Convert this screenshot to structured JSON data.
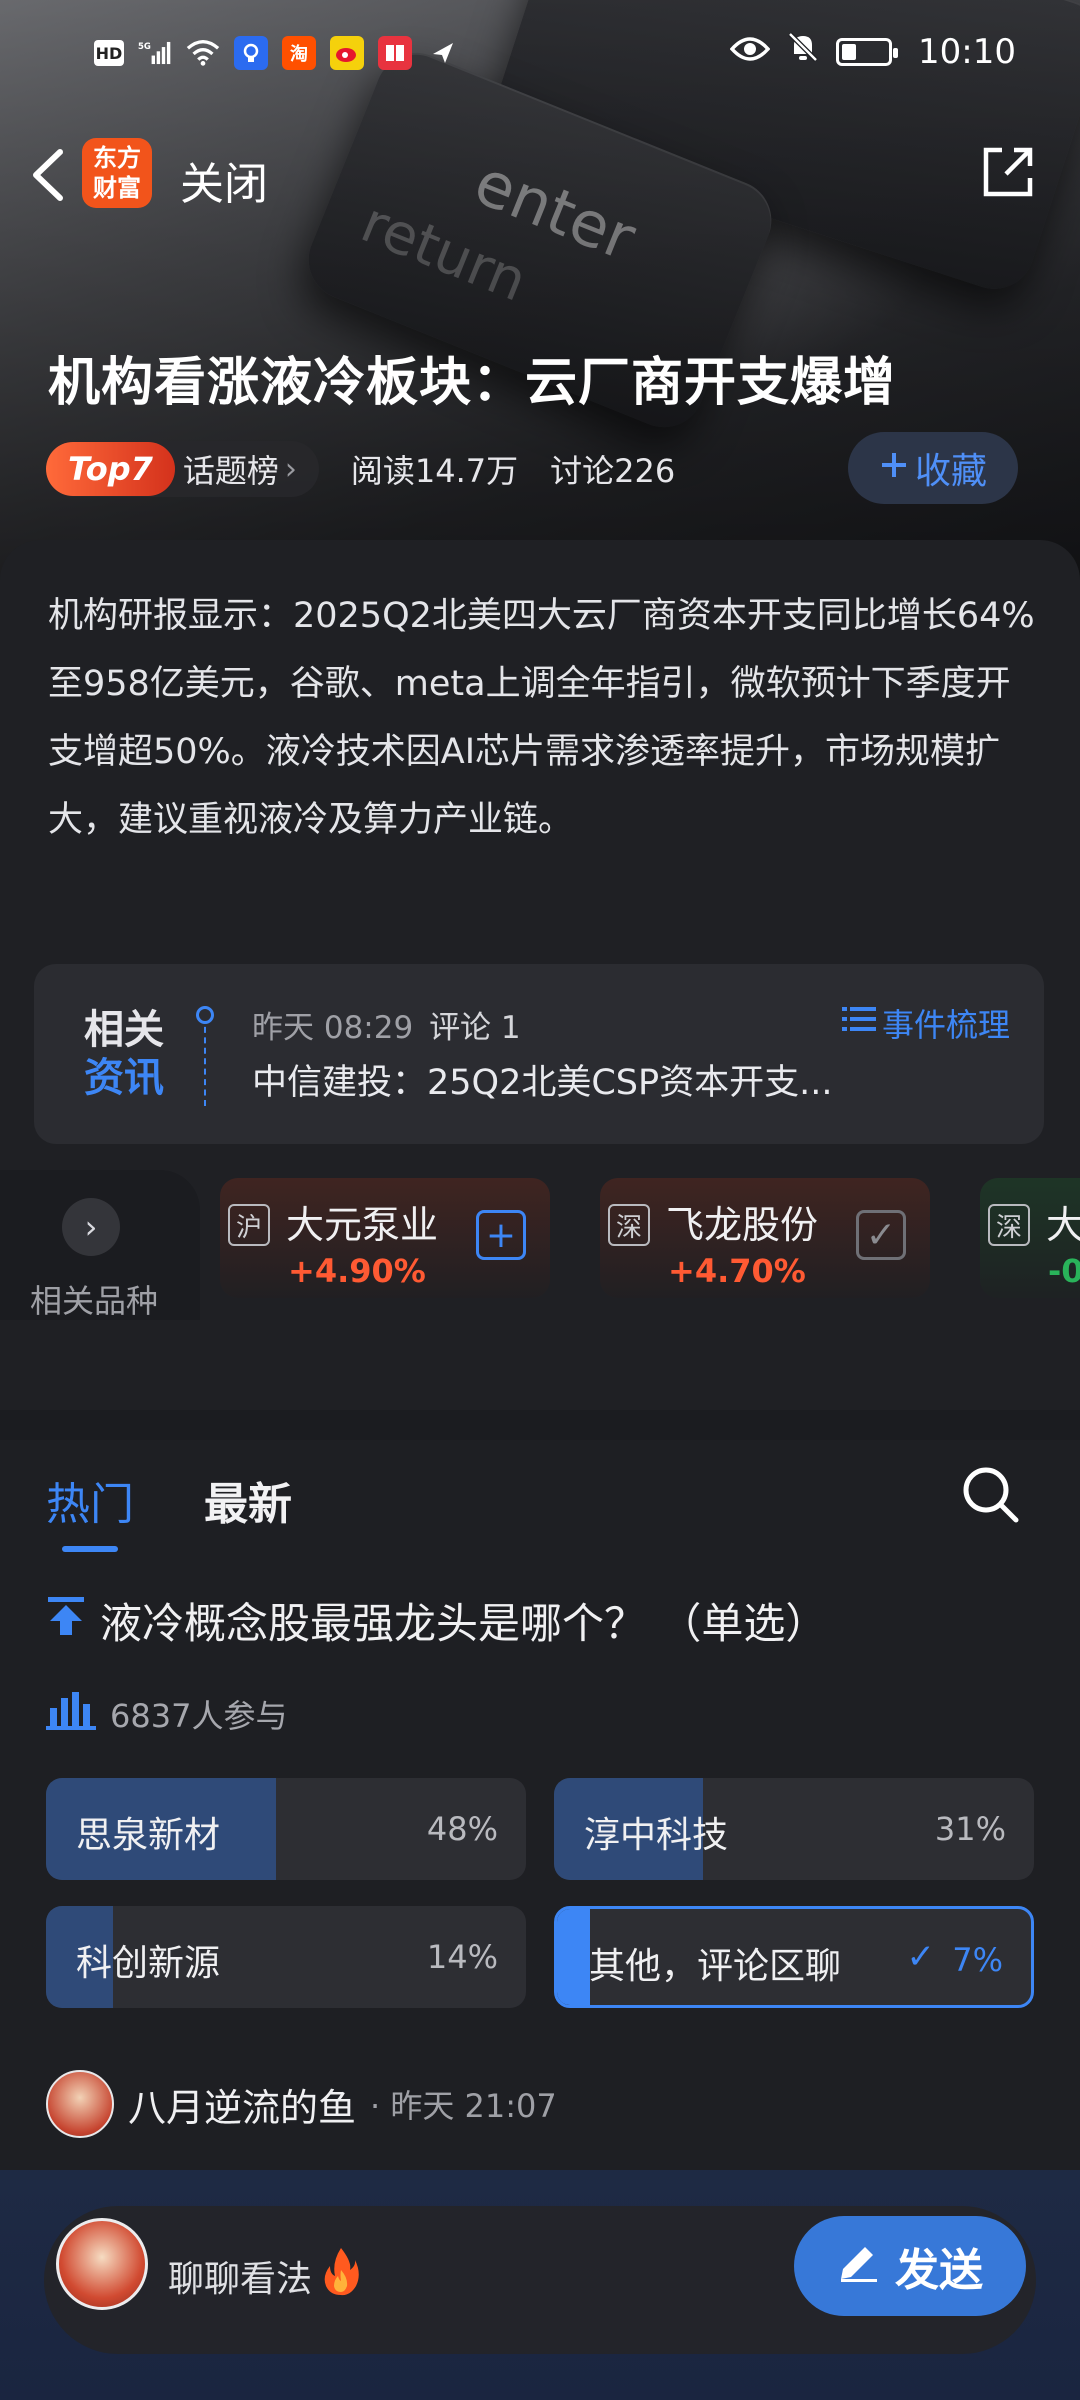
{
  "status_bar": {
    "time": "10:10",
    "left_icons": [
      "hd-icon",
      "signal-5g-icon",
      "wifi-icon",
      "browser-icon",
      "taobao-icon",
      "weibo-icon",
      "reader-icon",
      "send-icon"
    ],
    "hd": "HD",
    "taobao": "淘"
  },
  "nav": {
    "logo_line1": "东方",
    "logo_line2": "财富",
    "close_label": "关闭"
  },
  "hero": {
    "title": "机构看涨液冷板块：云厂商开支爆增",
    "key_text": "enter",
    "key_subtext": "return",
    "topic_badge": "Top7",
    "topic_label": "话题榜",
    "reads": "阅读14.7万",
    "discussions": "讨论226",
    "favorite_label": "收藏"
  },
  "summary": "机构研报显示：2025Q2北美四大云厂商资本开支同比增长64%至958亿美元，谷歌、meta上调全年指引，微软预计下季度开支增超50%。液冷技术因AI芯片需求渗透率提升，市场规模扩大，建议重视液冷及算力产业链。",
  "related_news": {
    "tag_line1": "相关",
    "tag_line2": "资讯",
    "time": "昨天 08:29",
    "comments": "评论 1",
    "headline": "中信建投：25Q2北美CSP资本开支...",
    "link_label": "事件梳理"
  },
  "related_stocks": {
    "label": "相关品种",
    "items": [
      {
        "exchange": "沪",
        "name": "大元泵业",
        "change": "+4.90%",
        "action": "add"
      },
      {
        "exchange": "深",
        "name": "飞龙股份",
        "change": "+4.70%",
        "action": "added"
      },
      {
        "exchange": "深",
        "name": "大",
        "change": "-0",
        "action": "none"
      }
    ]
  },
  "discussion": {
    "tabs": [
      "热门",
      "最新"
    ],
    "poll_question": "液冷概念股最强龙头是哪个？ （单选）",
    "participants": "6837人参与",
    "options": [
      {
        "label": "思泉新材",
        "percent": "48%",
        "fraction": 0.48,
        "selected": false
      },
      {
        "label": "淳中科技",
        "percent": "31%",
        "fraction": 0.31,
        "selected": false
      },
      {
        "label": "科创新源",
        "percent": "14%",
        "fraction": 0.14,
        "selected": false
      },
      {
        "label": "其他，评论区聊",
        "percent": "7%",
        "fraction": 0.07,
        "selected": true
      }
    ],
    "commenter_name": "八月逆流的鱼",
    "commenter_time": "· 昨天 21:07"
  },
  "bottom": {
    "placeholder": "聊聊看法",
    "send_label": "发送"
  },
  "colors": {
    "accent": "#3d86f5",
    "up": "#ff5a33",
    "down": "#29b35a",
    "brand": "#f2541b"
  }
}
